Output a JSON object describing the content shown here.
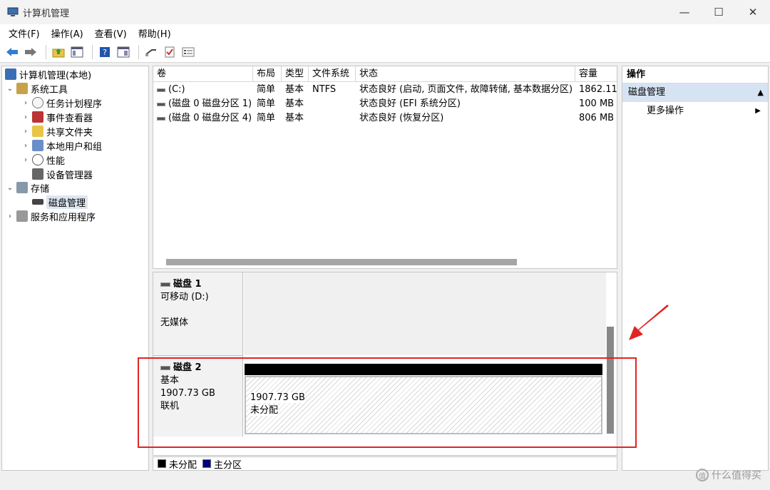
{
  "window": {
    "title": "计算机管理",
    "minimize": "—",
    "maximize": "☐",
    "close": "✕"
  },
  "menu": [
    "文件(F)",
    "操作(A)",
    "查看(V)",
    "帮助(H)"
  ],
  "tree": [
    {
      "label": "计算机管理(本地)",
      "chev": "",
      "level": 0
    },
    {
      "label": "系统工具",
      "chev": "⌄",
      "level": 0
    },
    {
      "label": "任务计划程序",
      "chev": "›",
      "level": 1
    },
    {
      "label": "事件查看器",
      "chev": "›",
      "level": 1
    },
    {
      "label": "共享文件夹",
      "chev": "›",
      "level": 1
    },
    {
      "label": "本地用户和组",
      "chev": "›",
      "level": 1
    },
    {
      "label": "性能",
      "chev": "›",
      "level": 1
    },
    {
      "label": "设备管理器",
      "chev": "",
      "level": 1
    },
    {
      "label": "存储",
      "chev": "⌄",
      "level": 0
    },
    {
      "label": "磁盘管理",
      "chev": "",
      "level": 1
    },
    {
      "label": "服务和应用程序",
      "chev": "›",
      "level": 0
    }
  ],
  "volume_table": {
    "columns": [
      "卷",
      "布局",
      "类型",
      "文件系统",
      "状态",
      "容量"
    ],
    "rows": [
      [
        "(C:)",
        "简单",
        "基本",
        "NTFS",
        "状态良好 (启动, 页面文件, 故障转储, 基本数据分区)",
        "1862.11"
      ],
      [
        "(磁盘 0 磁盘分区 1)",
        "简单",
        "基本",
        "",
        "状态良好 (EFI 系统分区)",
        "100 MB"
      ],
      [
        "(磁盘 0 磁盘分区 4)",
        "简单",
        "基本",
        "",
        "状态良好 (恢复分区)",
        "806 MB"
      ]
    ]
  },
  "disks": {
    "disk1": {
      "name": "磁盘 1",
      "line2": "可移动 (D:)",
      "line3": "无媒体"
    },
    "disk2": {
      "name": "磁盘 2",
      "line2": "基本",
      "line3": "1907.73 GB",
      "line4": "联机",
      "partition_size": "1907.73 GB",
      "partition_status": "未分配"
    }
  },
  "legend": {
    "unallocated": "未分配",
    "primary": "主分区",
    "unallocated_color": "#000000",
    "primary_color": "#000080"
  },
  "actions": {
    "header": "操作",
    "section": "磁盘管理",
    "more": "更多操作"
  },
  "watermark": "什么值得买",
  "colors": {
    "highlight": "#e02424",
    "selection": "#d6e3f3"
  }
}
